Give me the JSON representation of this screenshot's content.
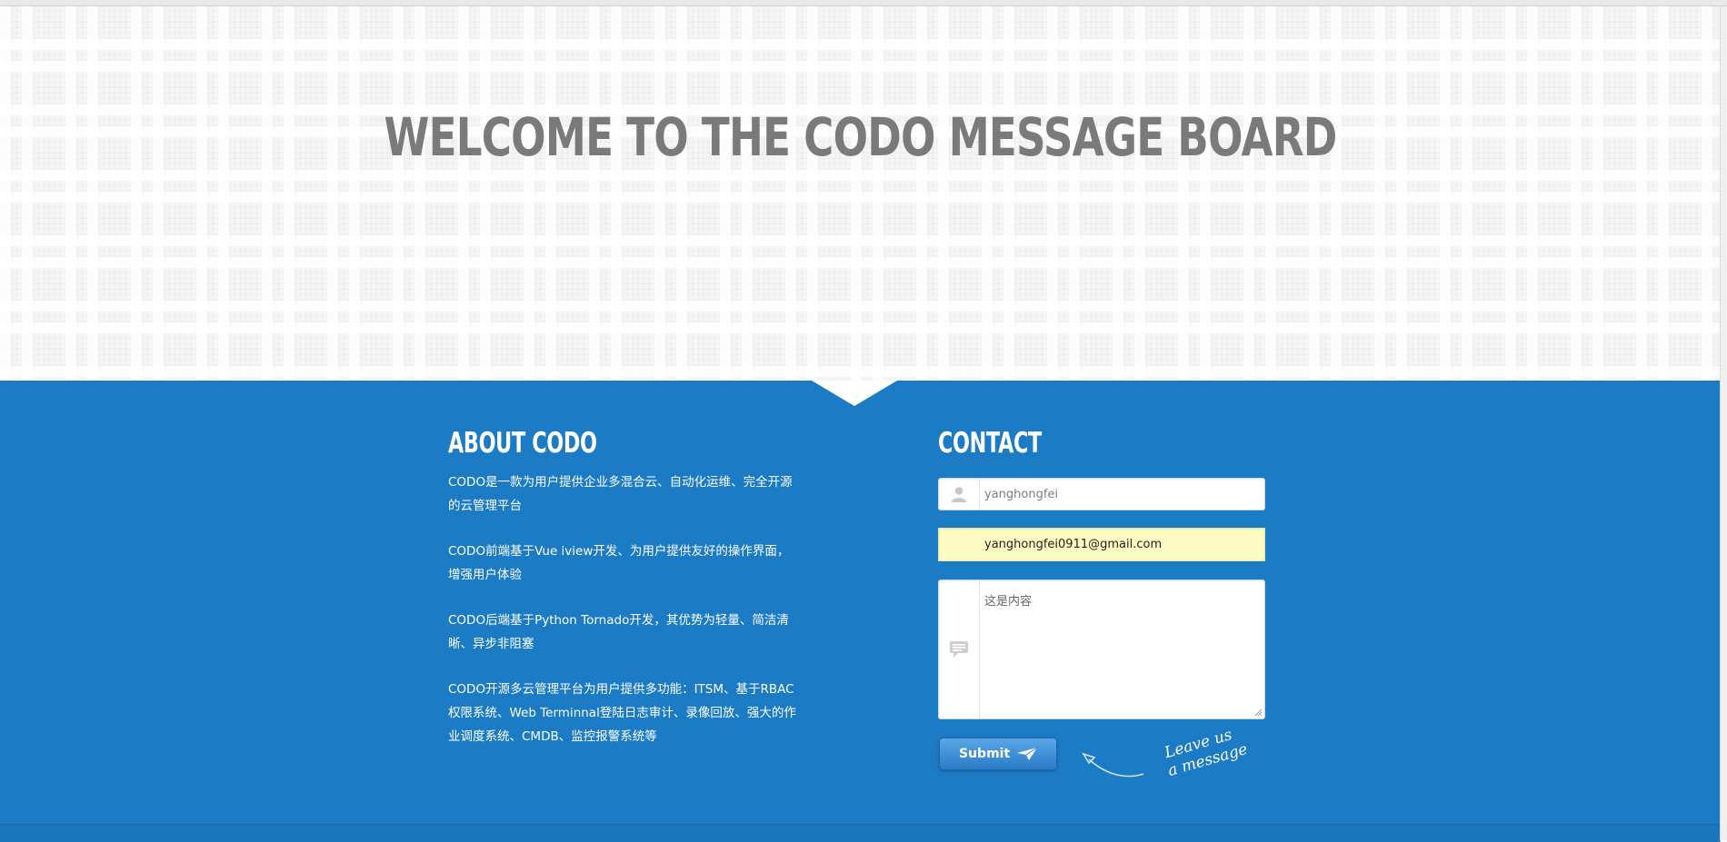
{
  "hero": {
    "title": "WELCOME TO THE CODO MESSAGE BOARD"
  },
  "about": {
    "heading": "ABOUT CODO",
    "paragraphs": [
      "CODO是一款为用户提供企业多混合云、自动化运维、完全开源的云管理平台",
      "CODO前端基于Vue iview开发、为用户提供友好的操作界面，增强用户体验",
      "CODO后端基于Python Tornado开发，其优势为轻量、简洁清晰、异步非阻塞",
      "CODO开源多云管理平台为用户提供多功能：ITSM、基于RBAC权限系统、Web Terminnal登陆日志审计、录像回放、强大的作业调度系统、CMDB、监控报警系统等"
    ]
  },
  "contact": {
    "heading": "CONTACT",
    "name_value": "yanghongfei",
    "email_value": "yanghongfei0911@gmail.com",
    "message_value": "这是内容",
    "submit_label": "Submit",
    "leave_line1": "Leave us",
    "leave_line2": "a message"
  },
  "colors": {
    "accent": "#1c7bc5",
    "hero_bg": "#f4f4f4",
    "title_gray": "#7a7a7a",
    "autofill_yellow": "#fdfbc2"
  },
  "icons": [
    "user-icon",
    "comment-icon",
    "paper-plane-icon",
    "curved-arrow-icon"
  ]
}
